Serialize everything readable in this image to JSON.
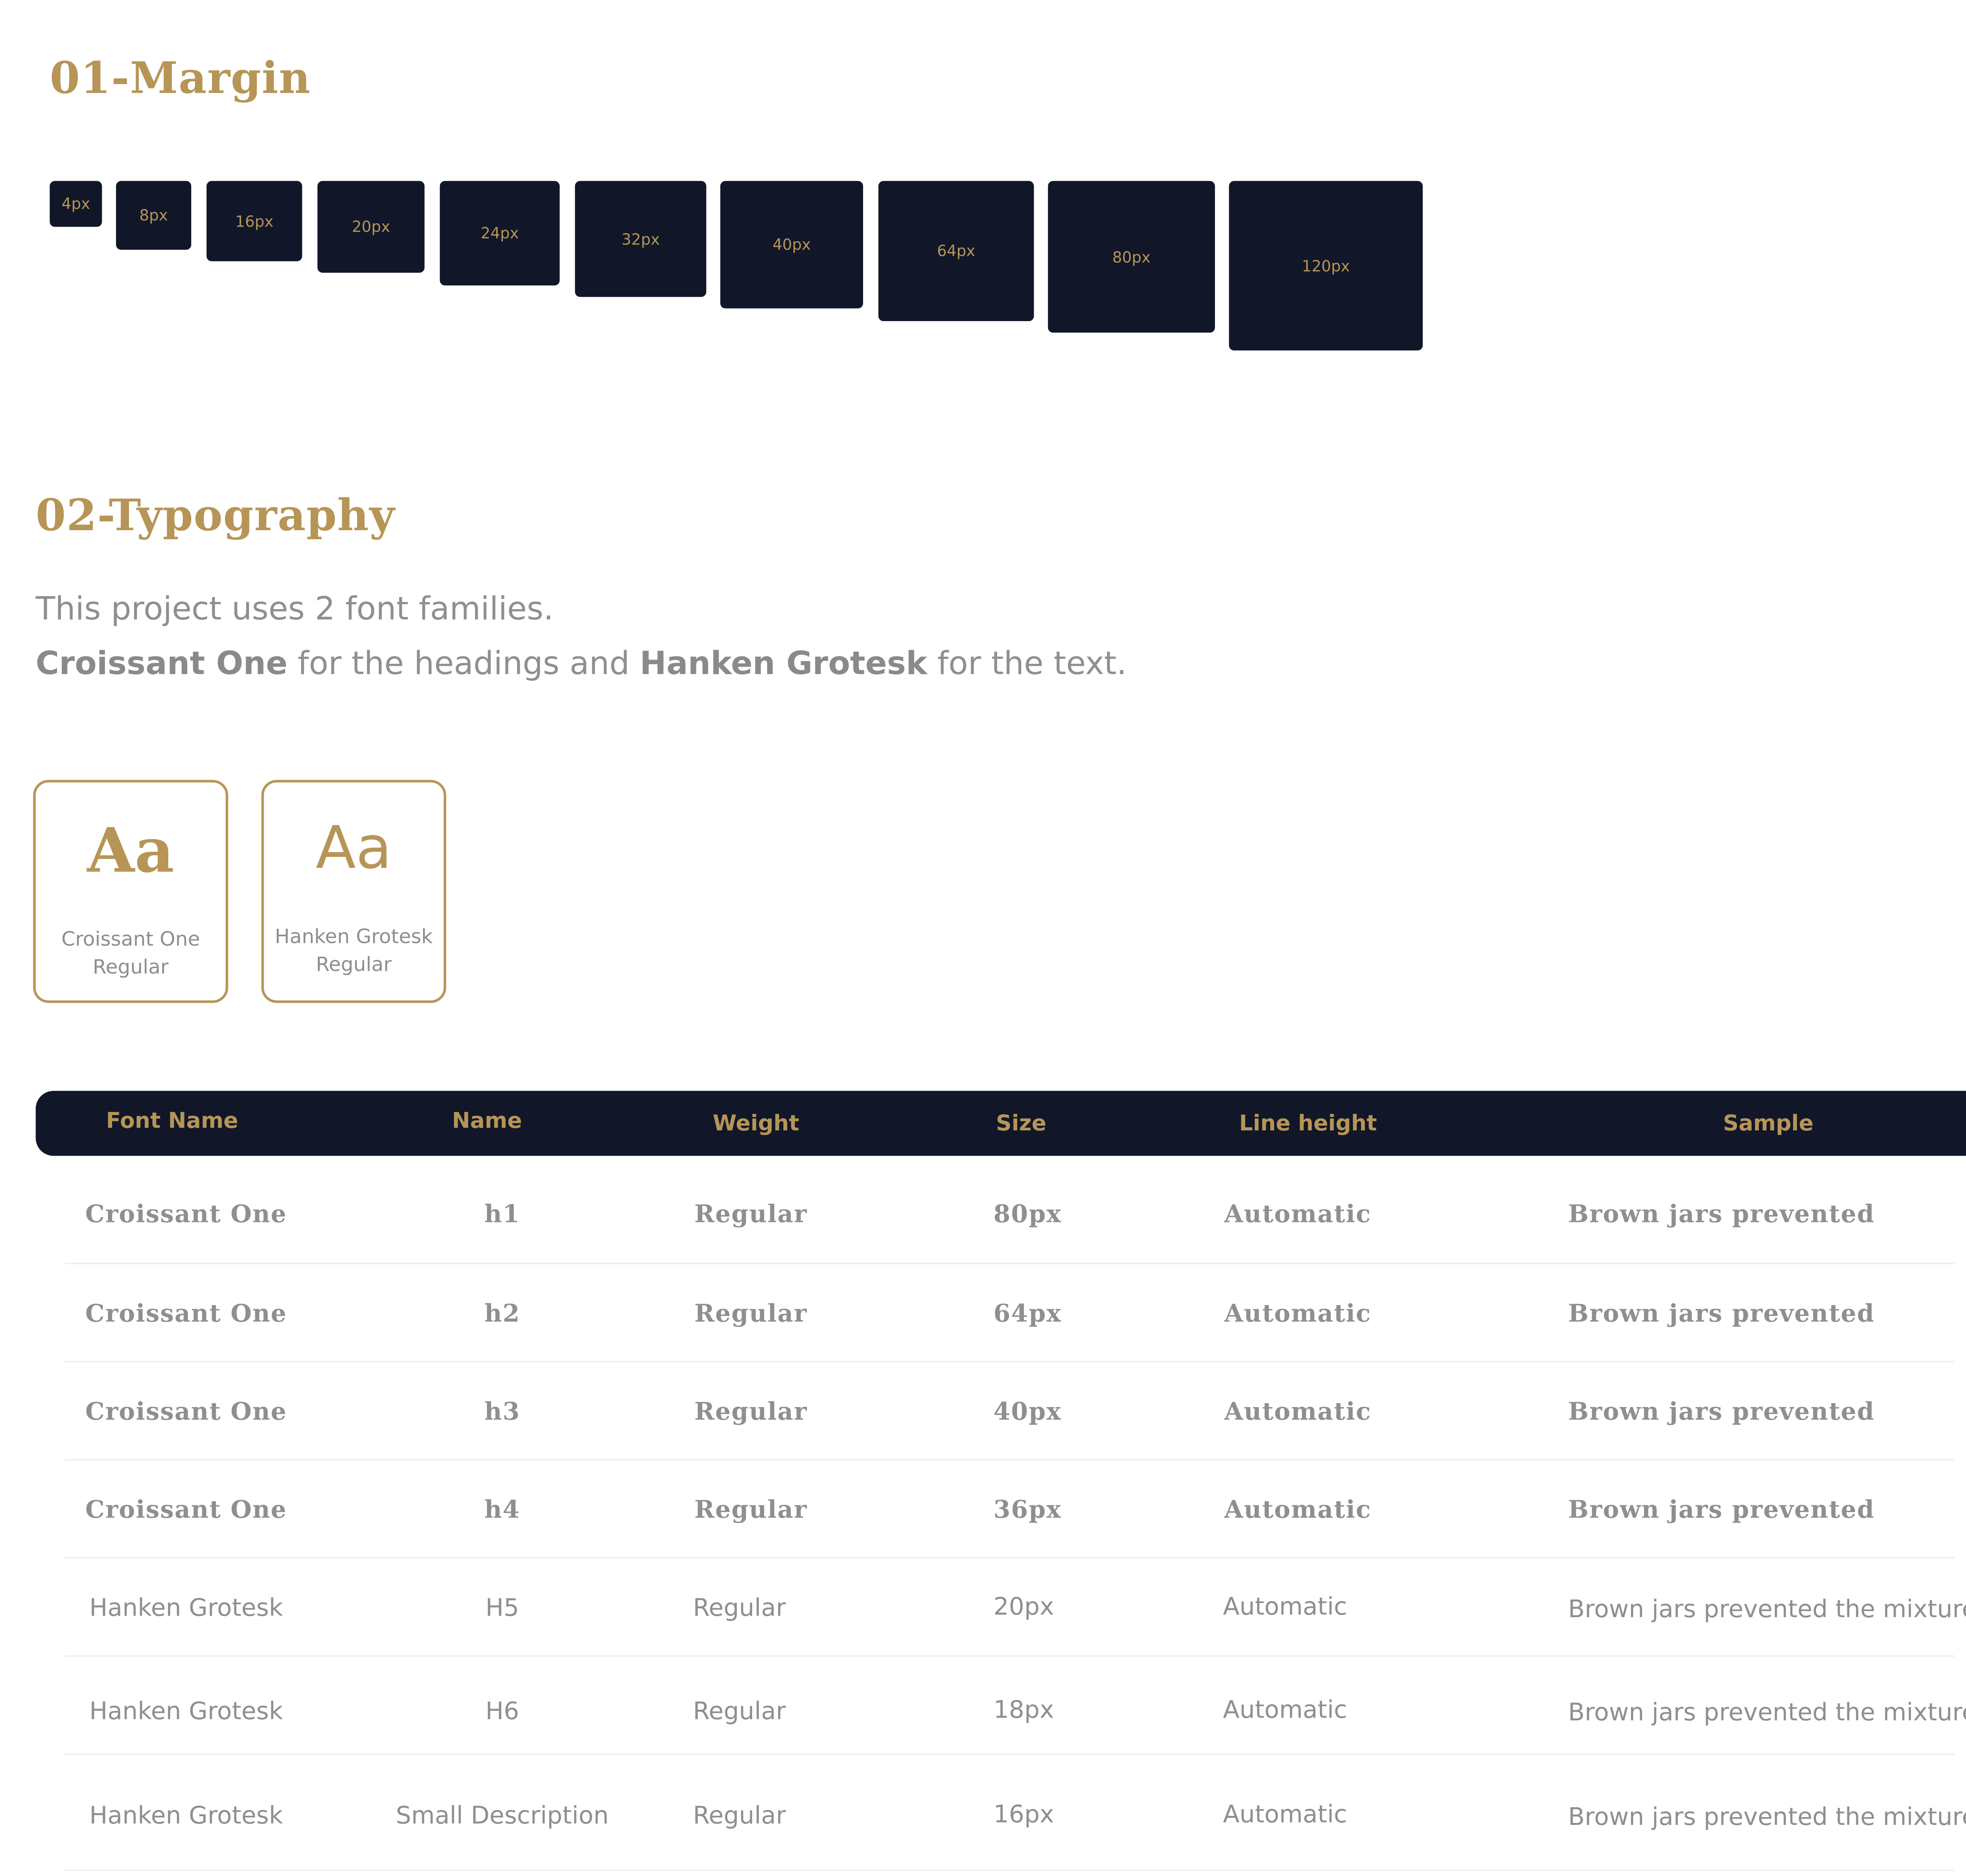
{
  "margin_section": {
    "title": "01-Margin",
    "swatches": [
      "4px",
      "8px",
      "16px",
      "20px",
      "24px",
      "32px",
      "40px",
      "64px",
      "80px",
      "120px"
    ]
  },
  "typography_section": {
    "title": "02-Typography",
    "intro_line1": "This project uses 2 font families.",
    "intro_line2": {
      "font1": "Croissant One",
      "mid": " for the headings and ",
      "font2": "Hanken Grotesk",
      "end": " for the text."
    },
    "cards": [
      {
        "glyph": "Aa",
        "name": "Croissant One",
        "style": "Regular"
      },
      {
        "glyph": "Aa",
        "name": "Hanken Grotesk",
        "style": "Regular"
      }
    ]
  },
  "table": {
    "headers": [
      "Font Name",
      "Name",
      "Weight",
      "Size",
      "Line height",
      "Sample"
    ],
    "rows": [
      [
        "Croissant One",
        "h1",
        "Regular",
        "80px",
        "Automatic",
        "Brown jars prevented"
      ],
      [
        "Croissant One",
        "h2",
        "Regular",
        "64px",
        "Automatic",
        "Brown jars prevented"
      ],
      [
        "Croissant One",
        "h3",
        "Regular",
        "40px",
        "Automatic",
        "Brown jars prevented"
      ],
      [
        "Croissant One",
        "h4",
        "Regular",
        "36px",
        "Automatic",
        "Brown jars prevented"
      ],
      [
        "Hanken Grotesk",
        "H5",
        "Regular",
        "20px",
        "Automatic",
        "Brown jars prevented the mixture"
      ],
      [
        "Hanken Grotesk",
        "H6",
        "Regular",
        "18px",
        "Automatic",
        "Brown jars prevented the mixture"
      ],
      [
        "Hanken Grotesk",
        "Small Description",
        "Regular",
        "16px",
        "Automatic",
        "Brown jars prevented the mixture"
      ]
    ]
  },
  "colors": {
    "accent": "#b69556",
    "dark": "#111729",
    "muted_text": "#8f8f8f"
  }
}
